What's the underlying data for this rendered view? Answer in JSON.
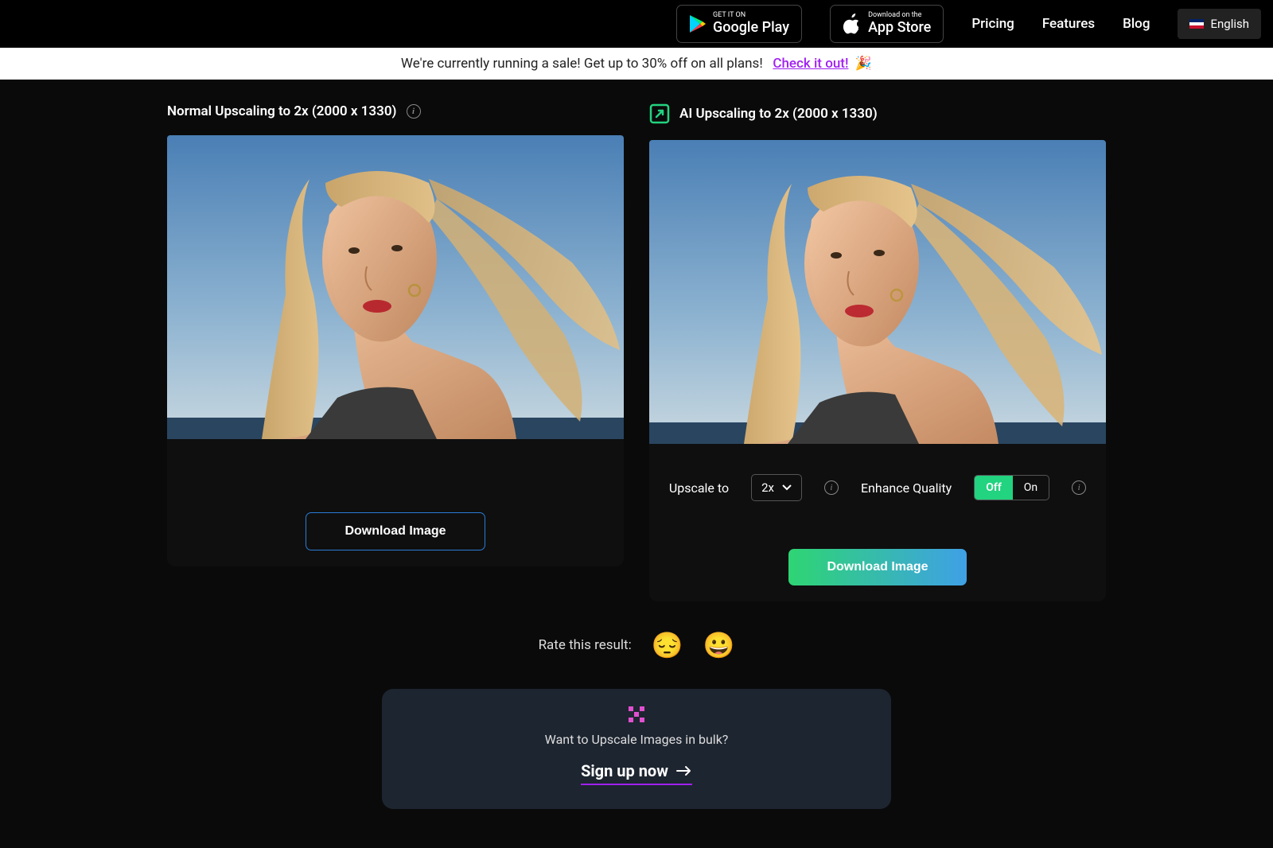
{
  "header": {
    "google_play": {
      "top": "GET IT ON",
      "bottom": "Google Play"
    },
    "app_store": {
      "top": "Download on the",
      "bottom": "App Store"
    },
    "nav": {
      "pricing": "Pricing",
      "features": "Features",
      "blog": "Blog"
    },
    "lang": "English"
  },
  "sale": {
    "text": "We're currently running a sale! Get up to 30% off on all plans!",
    "link": "Check it out!",
    "emoji": "🎉"
  },
  "left": {
    "title": "Normal Upscaling to 2x (2000 x 1330)",
    "download": "Download Image"
  },
  "right": {
    "title": "AI Upscaling to 2x (2000 x 1330)",
    "upscale_label": "Upscale to",
    "upscale_value": "2x",
    "enhance_label": "Enhance Quality",
    "toggle_off": "Off",
    "toggle_on": "On",
    "download": "Download Image"
  },
  "rate": {
    "label": "Rate this result:",
    "sad": "😔",
    "happy": "😀"
  },
  "cta": {
    "text": "Want to Upscale Images in bulk?",
    "link": "Sign up now"
  }
}
